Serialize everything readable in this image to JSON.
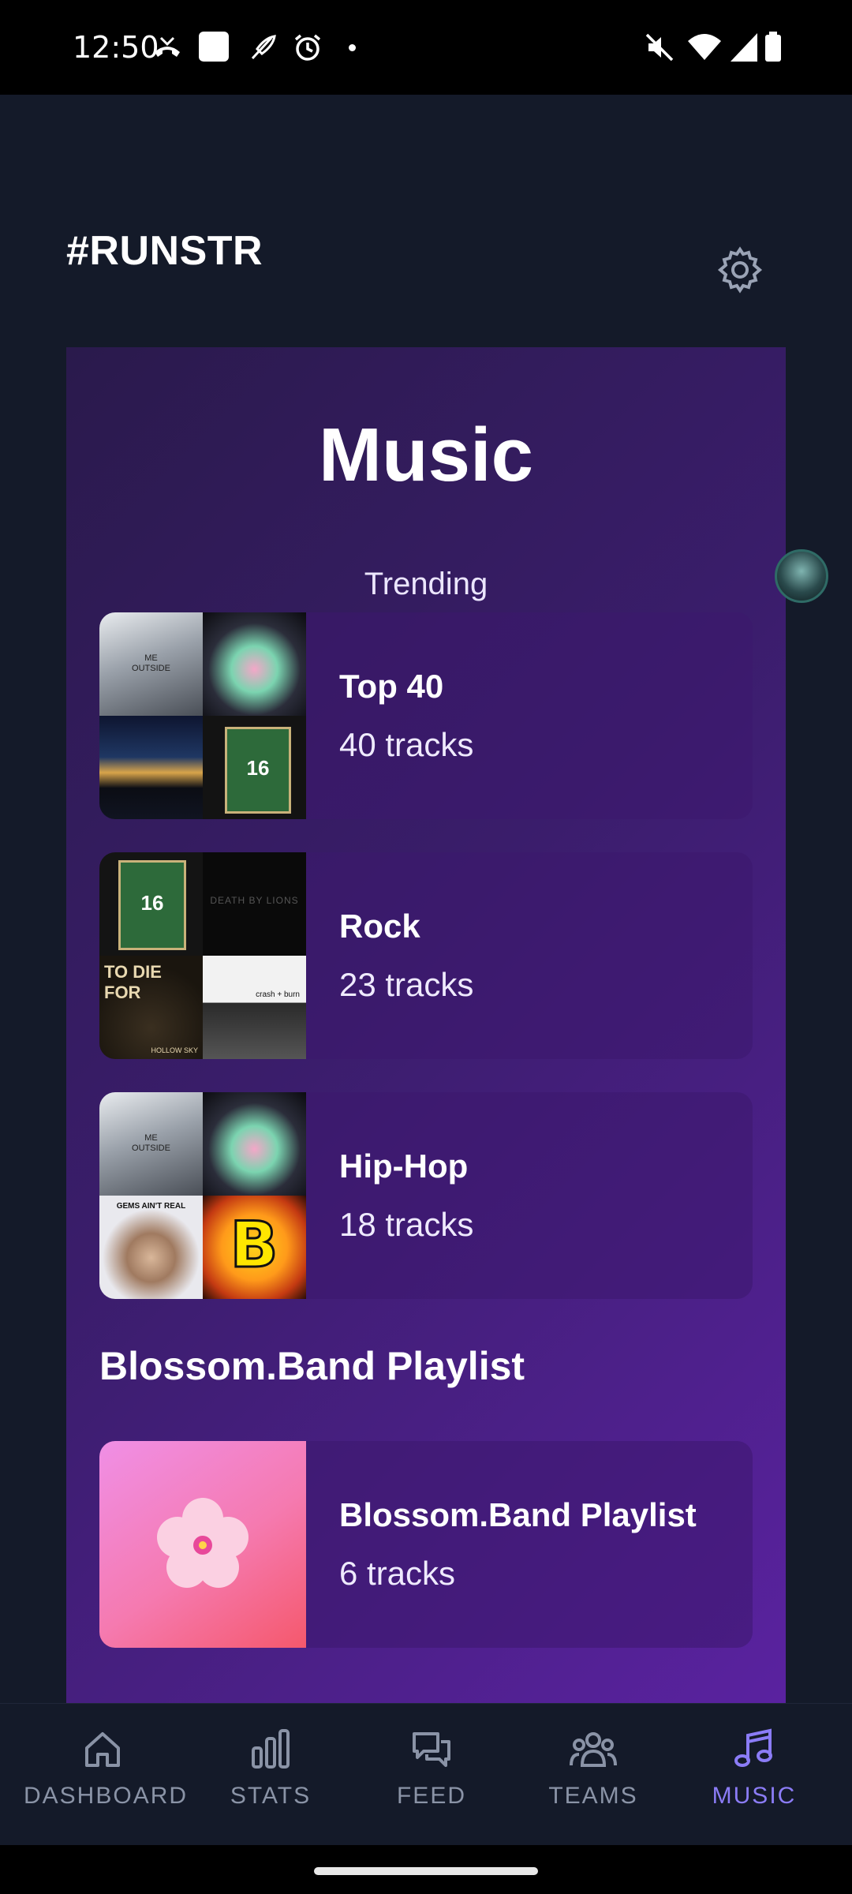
{
  "status_bar": {
    "time": "12:50"
  },
  "header": {
    "brand": "#RUNSTR"
  },
  "music": {
    "title": "Music",
    "trending_label": "Trending",
    "playlists": [
      {
        "name": "Top 40",
        "count": "40 tracks"
      },
      {
        "name": "Rock",
        "count": "23 tracks"
      },
      {
        "name": "Hip-Hop",
        "count": "18 tracks"
      }
    ],
    "section_title": "Blossom.Band Playlist",
    "blossom": {
      "name": "Blossom.Band Playlist",
      "count": "6 tracks"
    },
    "art_text": {
      "me_outside": "ME\nOUTSIDE",
      "jersey": "16",
      "to_die_for": "TO DIE FOR",
      "hollow_sky": "HOLLOW SKY",
      "death_by_lions": "DEATH BY LIONS",
      "crash_burn": "crash + burn",
      "gems": "GEMS AIN'T REAL"
    }
  },
  "nav": {
    "items": [
      {
        "label": "DASHBOARD",
        "icon": "home-icon"
      },
      {
        "label": "STATS",
        "icon": "bar-chart-icon"
      },
      {
        "label": "FEED",
        "icon": "chat-bubbles-icon"
      },
      {
        "label": "TEAMS",
        "icon": "people-icon"
      },
      {
        "label": "MUSIC",
        "icon": "music-note-icon"
      }
    ],
    "active": "MUSIC"
  },
  "colors": {
    "background": "#141a29",
    "card_gradient_start": "#2a1a4c",
    "card_gradient_end": "#5a22a0",
    "nav_active": "#8b7cf6",
    "nav_inactive": "#8a93a6"
  }
}
